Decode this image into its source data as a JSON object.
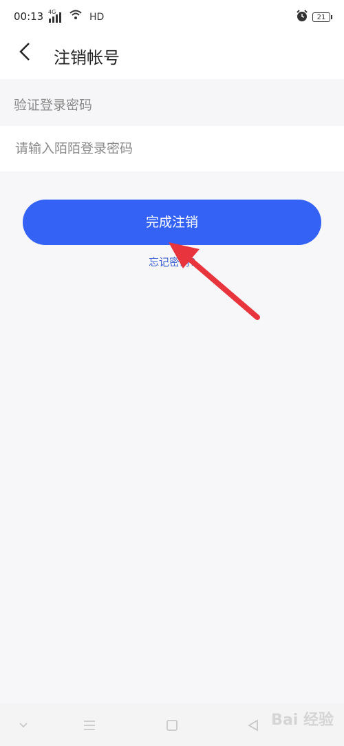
{
  "status_bar": {
    "time": "00:13",
    "network": "4G",
    "hd": "HD",
    "battery": "21"
  },
  "header": {
    "title": "注销帐号"
  },
  "form": {
    "section_label": "验证登录密码",
    "password_placeholder": "请输入陌陌登录密码",
    "submit_label": "完成注销",
    "forgot_label": "忘记密码?"
  },
  "watermark": "Bai 经验",
  "colors": {
    "accent": "#3462f5",
    "link": "#3a5fd0",
    "arrow": "#e8343c"
  }
}
